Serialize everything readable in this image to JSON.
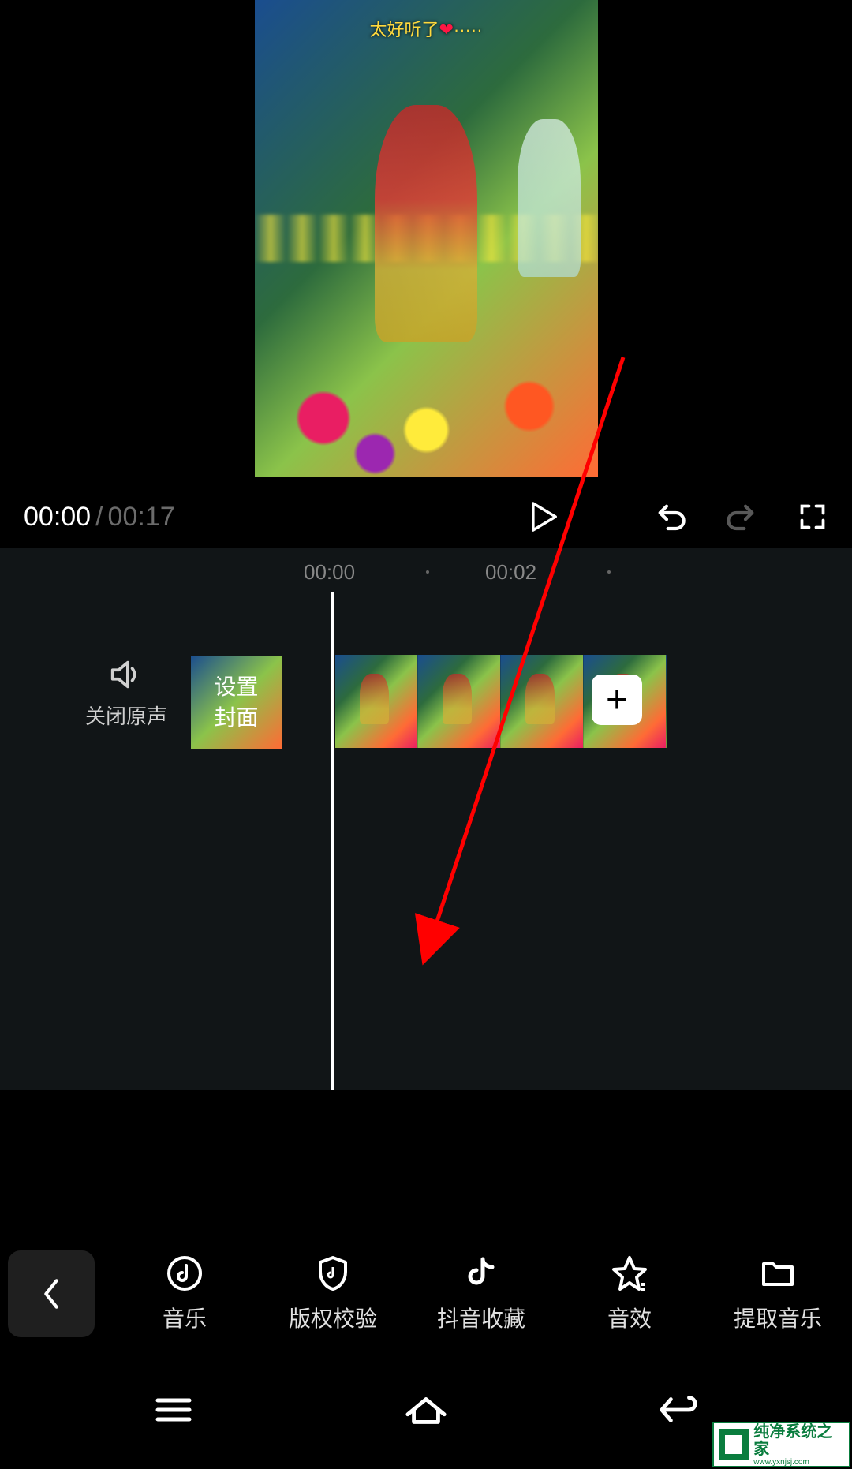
{
  "preview": {
    "overlay_text": "太好听了",
    "heart": "❤",
    "dots": "·····"
  },
  "controls": {
    "current_time": "00:00",
    "total_time": "00:17"
  },
  "timeline": {
    "ruler_0": "00:00",
    "ruler_2": "00:02",
    "mute_label": "关闭原声",
    "cover_line1": "设置",
    "cover_line2": "封面",
    "add_symbol": "+"
  },
  "toolbar": {
    "music": "音乐",
    "copyright": "版权校验",
    "douyin_fav": "抖音收藏",
    "sound_fx": "音效",
    "extract_music": "提取音乐"
  },
  "watermark": {
    "title": "纯净系统之家",
    "sub": "www.yxnjsj.com"
  }
}
